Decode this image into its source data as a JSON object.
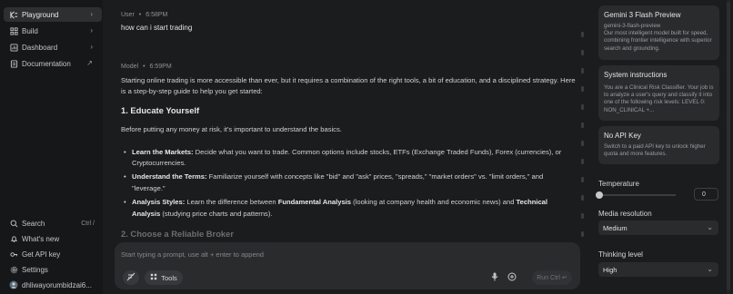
{
  "sidebar": {
    "items": [
      {
        "label": "Playground",
        "icon": "playground-icon",
        "active": true
      },
      {
        "label": "Build",
        "icon": "build-icon"
      },
      {
        "label": "Dashboard",
        "icon": "dashboard-icon"
      },
      {
        "label": "Documentation",
        "icon": "documentation-icon"
      }
    ],
    "bottom": {
      "search": {
        "label": "Search",
        "shortcut": "Ctrl /"
      },
      "whats_new": "What's new",
      "api_key": "Get API key",
      "settings": "Settings",
      "user": "dhliwayorumbidzai6..."
    }
  },
  "chat": {
    "user_msg": {
      "role": "User",
      "time": "6:58PM",
      "text": "how can i start trading"
    },
    "model_msg": {
      "role": "Model",
      "time": "6:59PM",
      "intro": "Starting online trading is more accessible than ever, but it requires a combination of the right tools, a bit of education, and a disciplined strategy. Here is a step-by-step guide to help you get started:",
      "h1": "1. Educate Yourself",
      "p1": "Before putting any money at risk, it's important to understand the basics.",
      "bullets": [
        {
          "bold": "Learn the Markets:",
          "text": " Decide what you want to trade. Common options include stocks, ETFs (Exchange Traded Funds), Forex (currencies), or Cryptocurrencies."
        },
        {
          "bold": "Understand the Terms:",
          "text": " Familiarize yourself with concepts like \"bid\" and \"ask\" prices, \"spreads,\" \"market orders\" vs. \"limit orders,\" and \"leverage.\""
        },
        {
          "bold": "Analysis Styles:",
          "text": " Learn the difference between ",
          "bold2": "Fundamental Analysis",
          "text2": " (looking at company health and economic news) and ",
          "bold3": "Technical Analysis",
          "text3": " (studying price charts and patterns)."
        }
      ],
      "h2": "2. Choose a Reliable Broker"
    }
  },
  "prompt": {
    "placeholder": "Start typing a prompt, use alt + enter to append",
    "tools_label": "Tools",
    "run_label": "Run Ctrl ↵"
  },
  "right_panel": {
    "model_card": {
      "title": "Gemini 3 Flash Preview",
      "id": "gemini-3-flash-preview",
      "desc": "Our most intelligent model built for speed, combining frontier intelligence with superior search and grounding."
    },
    "system_card": {
      "title": "System instructions",
      "desc": "You are a Clinical Risk Classifier. Your job is to analyze a user's query and classify it into one of the following risk levels: LEVEL 0: NON_CLINICAL +..."
    },
    "api_card": {
      "title": "No API Key",
      "desc": "Switch to a paid API key to unlock higher quota and more features."
    },
    "temperature": {
      "label": "Temperature",
      "value": "0",
      "fraction": 0.0
    },
    "media_resolution": {
      "label": "Media resolution",
      "value": "Medium"
    },
    "thinking_level": {
      "label": "Thinking level",
      "value": "High"
    }
  }
}
